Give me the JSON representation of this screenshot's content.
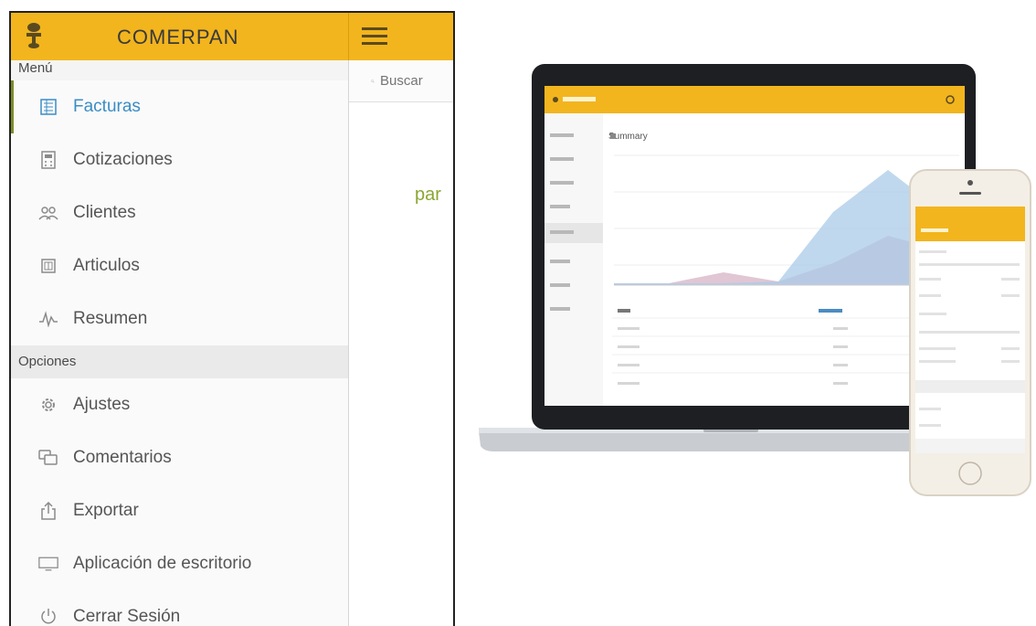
{
  "app": {
    "brand": "COMERPAN",
    "search_placeholder": "Buscar",
    "teaser_text": "par",
    "menu_header": "Menú",
    "options_header": "Opciones",
    "menu_items": [
      {
        "label": "Facturas",
        "icon": "invoice-icon",
        "active": true
      },
      {
        "label": "Cotizaciones",
        "icon": "calculator-icon",
        "active": false
      },
      {
        "label": "Clientes",
        "icon": "users-icon",
        "active": false
      },
      {
        "label": "Articulos",
        "icon": "box-icon",
        "active": false
      },
      {
        "label": "Resumen",
        "icon": "pulse-icon",
        "active": false
      }
    ],
    "option_items": [
      {
        "label": "Ajustes",
        "icon": "gear-icon"
      },
      {
        "label": "Comentarios",
        "icon": "comments-icon"
      },
      {
        "label": "Exportar",
        "icon": "export-icon"
      },
      {
        "label": "Aplicación de escritorio",
        "icon": "monitor-icon"
      },
      {
        "label": "Cerrar Sesión",
        "icon": "logout-icon"
      }
    ],
    "colors": {
      "accent": "#f2b51e",
      "active_text": "#3a8dc4",
      "active_border": "#7d8c2b"
    }
  },
  "mockup": {
    "laptop_summary_title": "Summary",
    "colors": {
      "area_blue": "#a9cbe8",
      "area_pink": "#d9b8c8"
    }
  }
}
